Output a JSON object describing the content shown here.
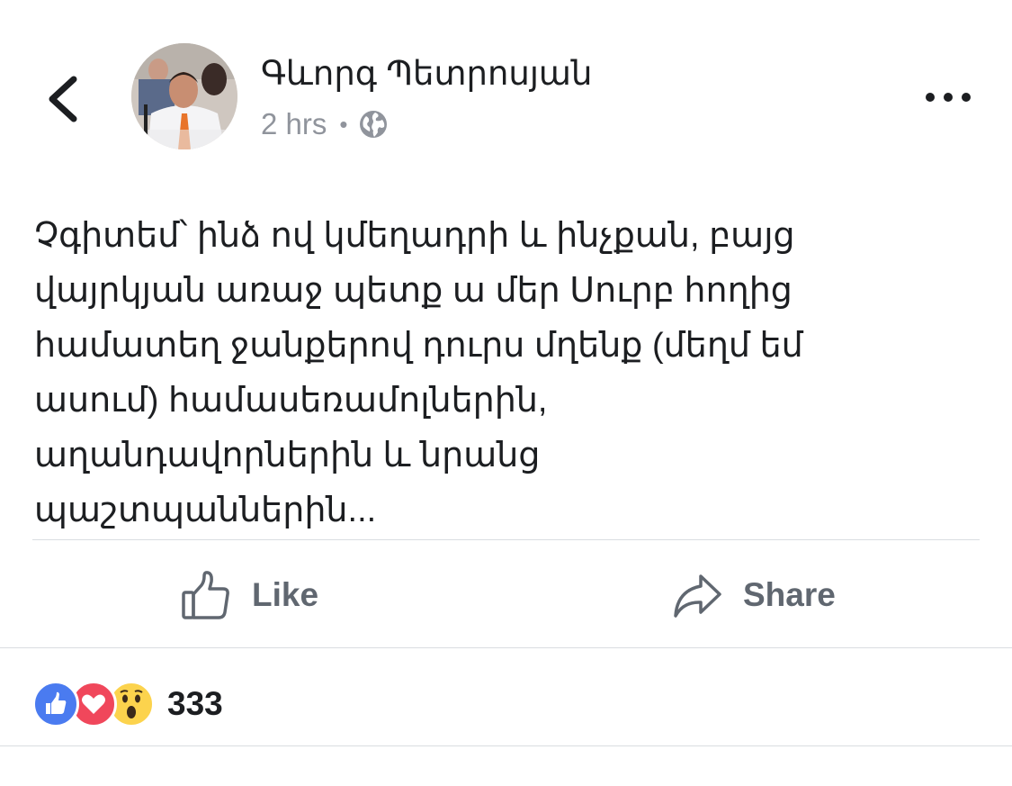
{
  "header": {
    "author_name": "Գևորգ Պետրոսյան",
    "time": "2 hrs",
    "separator": "•",
    "privacy_icon": "globe-icon",
    "back_icon": "chevron-left-icon",
    "more_icon": "more-horizontal-icon"
  },
  "post": {
    "text": "Չգիտեմ՝ ինձ ով կմեղադրի և ինչքան, բայց\nվայրկյան առաջ պետք ա մեր Սուրբ հողից\nհամատեղ ջանքերով դուրս մղենք (մեղմ եմ\nասում) համասեռամոլներին,\nաղանդավորներին և նրանց\nպաշտպաններին..."
  },
  "actions": {
    "like_label": "Like",
    "like_icon": "thumbs-up-icon",
    "share_label": "Share",
    "share_icon": "share-arrow-icon"
  },
  "reactions": {
    "icons": [
      "like-reaction-icon",
      "love-reaction-icon",
      "wow-reaction-icon"
    ],
    "count": "333"
  },
  "colors": {
    "like_blue": "#4a7bf0",
    "love_red": "#f0475b",
    "wow_yellow": "#fcd34d",
    "secondary_text": "#90949c",
    "action_text": "#606770"
  }
}
